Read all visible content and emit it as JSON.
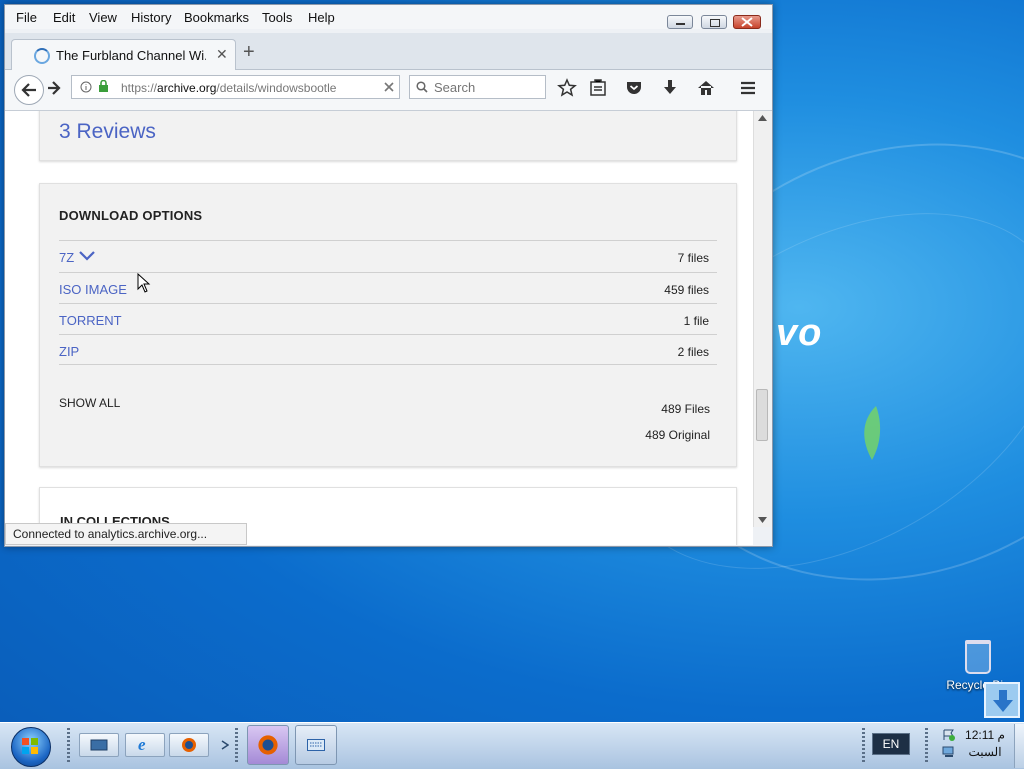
{
  "desktop": {
    "logo_fragment": "vo",
    "recycle_bin_label": "Recycle Bin"
  },
  "window": {
    "menu": [
      "File",
      "Edit",
      "View",
      "History",
      "Bookmarks",
      "Tools",
      "Help"
    ],
    "tab": {
      "title": "The Furbland Channel Wi..."
    },
    "url": {
      "prefix": "https://",
      "host": "archive.org",
      "path": "/details/windowsbootle"
    },
    "search_placeholder": "Search",
    "status_text": "Connected to analytics.archive.org..."
  },
  "page": {
    "reviews_heading": "3 Reviews",
    "download": {
      "heading": "DOWNLOAD OPTIONS",
      "rows": [
        {
          "name": "7Z",
          "count": "7 files"
        },
        {
          "name": "ISO IMAGE",
          "count": "459 files"
        },
        {
          "name": "TORRENT",
          "count": "1 file"
        },
        {
          "name": "ZIP",
          "count": "2 files"
        }
      ],
      "show_all": "SHOW ALL",
      "total_files": "489 Files",
      "total_original": "489 Original"
    },
    "collections_heading": "IN COLLECTIONS"
  },
  "taskbar": {
    "language": "EN",
    "clock_time": "12:11 م",
    "clock_day": "السبت"
  },
  "colors": {
    "link": "#4b64c4",
    "accent": "#1f8ee0"
  }
}
